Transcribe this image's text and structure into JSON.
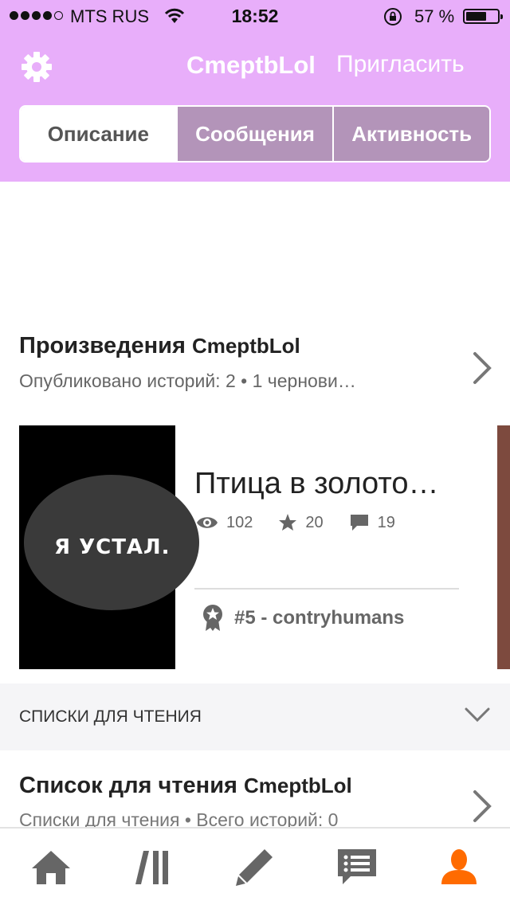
{
  "status_bar": {
    "carrier": "MTS RUS",
    "time": "18:52",
    "battery": "57 %"
  },
  "header": {
    "username": "CmeptbLol",
    "invite_label": "Пригласить",
    "tabs": [
      {
        "label": "Описание",
        "active": true
      },
      {
        "label": "Сообщения",
        "active": false
      },
      {
        "label": "Активность",
        "active": false
      }
    ]
  },
  "works": {
    "title": "Произведения",
    "username": "CmeptbLol",
    "subtitle": "Опубликовано историй: 2 • 1 чернови…",
    "story": {
      "cover_text": "Я УСТАЛ.",
      "title": "Птица в золото…",
      "views": "102",
      "votes": "20",
      "comments": "19",
      "rank": "#5 - contryhumans"
    }
  },
  "reading_lists": {
    "section_label": "СПИСКИ ДЛЯ ЧТЕНИЯ",
    "title": "Список для чтения",
    "username": "CmeptbLol",
    "subtitle": "Списки для чтения • Всего историй: 0"
  },
  "tab_bar": {
    "items": [
      "home-icon",
      "library-icon",
      "write-icon",
      "messages-icon",
      "profile-icon"
    ],
    "active": "profile-icon",
    "active_color": "#ff6b00",
    "inactive_color": "#666666"
  },
  "colors": {
    "header_bg": "#e8aefa",
    "tab_inactive_bg": "#b394b9"
  }
}
